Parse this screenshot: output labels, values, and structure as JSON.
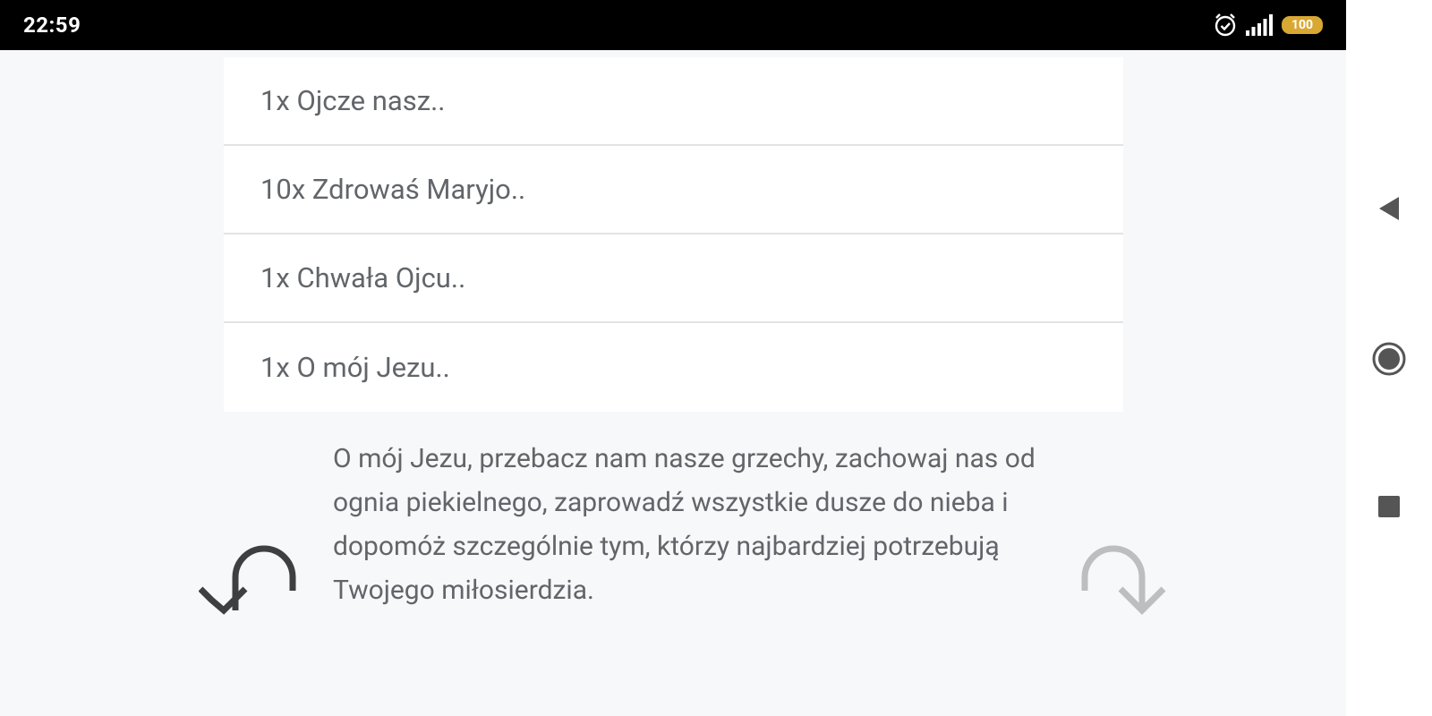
{
  "status_bar": {
    "time": "22:59",
    "battery_level": "100",
    "icons": [
      "alarm-icon",
      "signal-icon",
      "battery-icon"
    ]
  },
  "prayer_list": {
    "items": [
      {
        "label": "1x Ojcze nasz.."
      },
      {
        "label": "10x Zdrowaś Maryjo.."
      },
      {
        "label": "1x Chwała Ojcu.."
      },
      {
        "label": "1x O mój Jezu.."
      }
    ]
  },
  "prayer_text": "O mój Jezu, przebacz nam nasze grzechy, zachowaj nas od ognia piekielnego, zaprowadź wszystkie dusze do nieba i dopomóż szczególnie tym, którzy najbardziej potrzebują Twojego miłosierdzia.",
  "navigation": {
    "previous_icon": "undo-arrow-icon",
    "next_icon": "redo-arrow-icon",
    "previous_color": "#3d3f41",
    "next_color": "#bdbebf"
  },
  "system_nav": {
    "buttons": [
      "back-icon",
      "home-icon",
      "recents-icon"
    ]
  },
  "colors": {
    "background": "#f7f8fa",
    "card": "#ffffff",
    "text": "#626569",
    "status_bar": "#000000",
    "battery": "#d9a833"
  }
}
